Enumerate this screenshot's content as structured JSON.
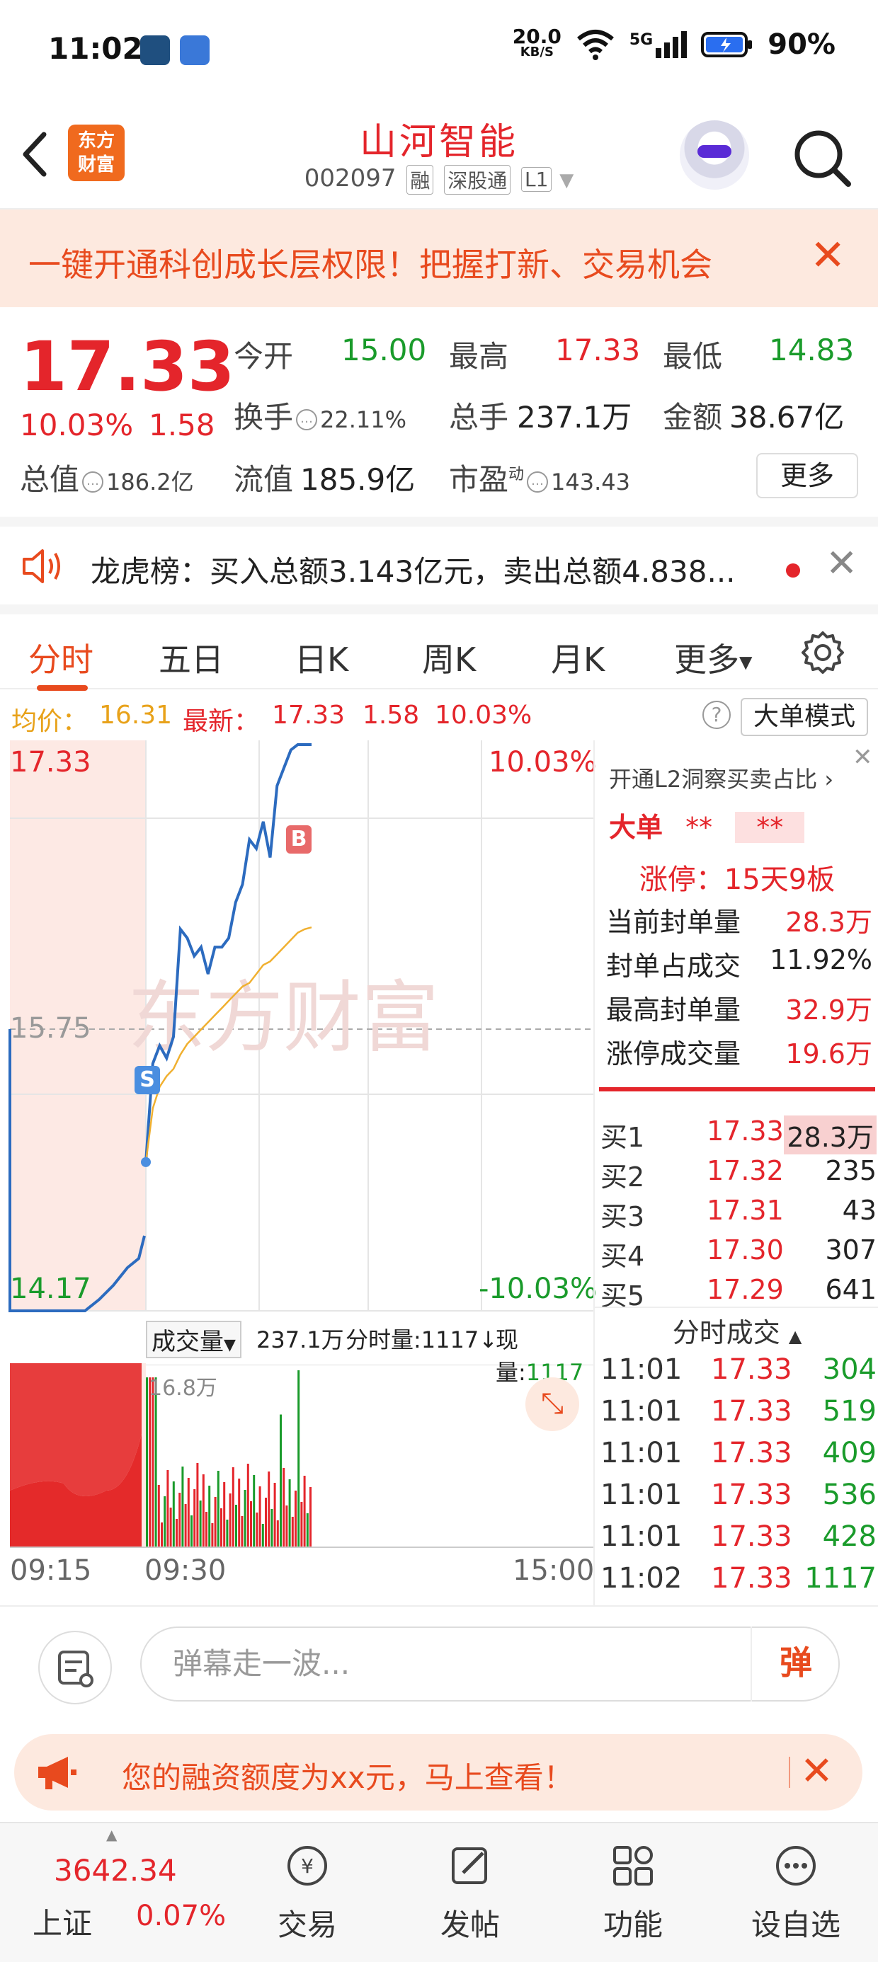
{
  "status_bar": {
    "time": "11:02",
    "net_speed": "20.0",
    "net_unit": "KB/S",
    "network": "5G",
    "battery": "90%"
  },
  "header": {
    "logo_line1": "东方",
    "logo_line2": "财富",
    "stock_name": "山河智能",
    "stock_code": "002097",
    "tags": [
      "融",
      "深股通",
      "L1"
    ]
  },
  "promo_banner": {
    "text": "一键开通科创成长层权限！把握打新、交易机会"
  },
  "quote": {
    "last_price": "17.33",
    "change_pct": "10.03%",
    "change_amt": "1.58",
    "open_label": "今开",
    "open": "15.00",
    "high_label": "最高",
    "high": "17.33",
    "low_label": "最低",
    "low": "14.83",
    "turnover_label": "换手",
    "turnover": "22.11%",
    "volume_label": "总手",
    "volume": "237.1万",
    "amount_label": "金额",
    "amount": "38.67亿",
    "mktcap_label": "总值",
    "mktcap": "186.2亿",
    "float_label": "流值",
    "float_cap": "185.9亿",
    "pe_label": "市盈",
    "pe_sup": "动",
    "pe": "143.43",
    "more_label": "更多"
  },
  "lhb": {
    "text": "龙虎榜：买入总额3.143亿元，卖出总额4.838..."
  },
  "tabs": [
    "分时",
    "五日",
    "日K",
    "周K",
    "月K",
    "更多"
  ],
  "avg_row": {
    "avg_label": "均价：",
    "avg": "16.31",
    "latest_label": "最新：",
    "latest": "17.33",
    "latest_chg": "1.58",
    "latest_pct": "10.03%",
    "help": "?",
    "big_order_label": "大单模式"
  },
  "chart": {
    "y_top": "17.33",
    "y_mid": "15.75",
    "y_bottom": "14.17",
    "pct_top": "10.03%",
    "pct_bottom": "-10.03%",
    "watermark": "东方财富",
    "marker_s": "S",
    "marker_b": "B",
    "vol_label": "成交量",
    "vol_total": "237.1万",
    "vol_per_label": "分时量:1117↓",
    "vol_now_label": "现量:",
    "vol_now": "1117",
    "vol_max": "16.8万",
    "x_start": "09:15",
    "x_open": "09:30",
    "x_end": "15:00"
  },
  "chart_data": {
    "type": "line",
    "title": "",
    "xlabel": "",
    "ylabel": "",
    "x": [
      "09:30",
      "09:32",
      "09:34",
      "09:36",
      "09:38",
      "09:40",
      "09:42",
      "09:44",
      "09:46",
      "09:50",
      "09:55",
      "10:00",
      "10:05",
      "10:10",
      "10:15",
      "10:20",
      "10:25",
      "10:30",
      "10:35",
      "10:40",
      "10:45",
      "10:50",
      "10:55",
      "11:00",
      "11:02"
    ],
    "series": [
      {
        "values": [
          15.0,
          15.55,
          15.65,
          15.58,
          15.7,
          16.3,
          16.25,
          16.15,
          16.2,
          16.05,
          16.2,
          16.2,
          16.25,
          16.45,
          16.55,
          16.8,
          16.75,
          16.9,
          16.7,
          17.1,
          17.2,
          17.3,
          17.33,
          17.33,
          17.33
        ]
      },
      {
        "values": [
          15.0,
          15.3,
          15.42,
          15.48,
          15.52,
          15.6,
          15.66,
          15.7,
          15.74,
          15.78,
          15.82,
          15.86,
          15.9,
          15.94,
          15.98,
          16.0,
          16.05,
          16.1,
          16.12,
          16.16,
          16.2,
          16.24,
          16.28,
          16.3,
          16.31
        ]
      }
    ],
    "ylim": [
      14.17,
      17.33
    ]
  },
  "side_panel": {
    "l2_label": "开通L2洞察买卖占比",
    "big_order": "大单",
    "stars1": "**",
    "stars2": "**",
    "limit_up": "涨停：15天9板",
    "seal_now_label": "当前封单量",
    "seal_now": "28.3万",
    "seal_ratio_label": "封单占成交",
    "seal_ratio": "11.92%",
    "seal_max_label": "最高封单量",
    "seal_max": "32.9万",
    "limit_vol_label": "涨停成交量",
    "limit_vol": "19.6万",
    "orderbook": [
      {
        "label": "买1",
        "price": "17.33",
        "vol": "28.3万"
      },
      {
        "label": "买2",
        "price": "17.32",
        "vol": "235"
      },
      {
        "label": "买3",
        "price": "17.31",
        "vol": "43"
      },
      {
        "label": "买4",
        "price": "17.30",
        "vol": "307"
      },
      {
        "label": "买5",
        "price": "17.29",
        "vol": "641"
      }
    ],
    "ticks_label": "分时成交",
    "ticks": [
      {
        "time": "11:01",
        "price": "17.33",
        "vol": "304"
      },
      {
        "time": "11:01",
        "price": "17.33",
        "vol": "519"
      },
      {
        "time": "11:01",
        "price": "17.33",
        "vol": "409"
      },
      {
        "time": "11:01",
        "price": "17.33",
        "vol": "536"
      },
      {
        "time": "11:01",
        "price": "17.33",
        "vol": "428"
      },
      {
        "time": "11:02",
        "price": "17.33",
        "vol": "1117"
      }
    ]
  },
  "danmaku": {
    "placeholder": "弹幕走一波...",
    "send": "弹"
  },
  "margin_ad": {
    "text": "您的融资额度为xx元，马上查看！"
  },
  "bottom_nav": {
    "index_value": "3642.34",
    "index_name": "上证",
    "index_pct": "0.07%",
    "items": [
      "交易",
      "发帖",
      "功能",
      "设自选"
    ]
  }
}
